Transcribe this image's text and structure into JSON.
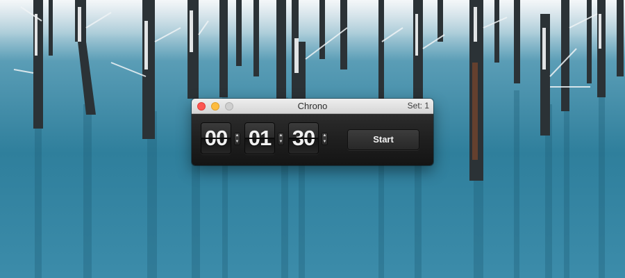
{
  "window": {
    "title": "Chrono",
    "set_label": "Set: 1"
  },
  "timer": {
    "hours": "00",
    "minutes": "01",
    "seconds": "30",
    "stepper_up": "▲",
    "stepper_down": "▼"
  },
  "controls": {
    "start_label": "Start"
  },
  "colors": {
    "close_button": "#fc5753",
    "minimize_button": "#fdbc40",
    "zoom_button": "#cfcfcf",
    "lake_blue": "#2f7f9c"
  },
  "icons": {
    "close": "close-icon",
    "minimize": "minimize-icon",
    "zoom": "zoom-icon",
    "stepper": "up-down-stepper-icon"
  }
}
